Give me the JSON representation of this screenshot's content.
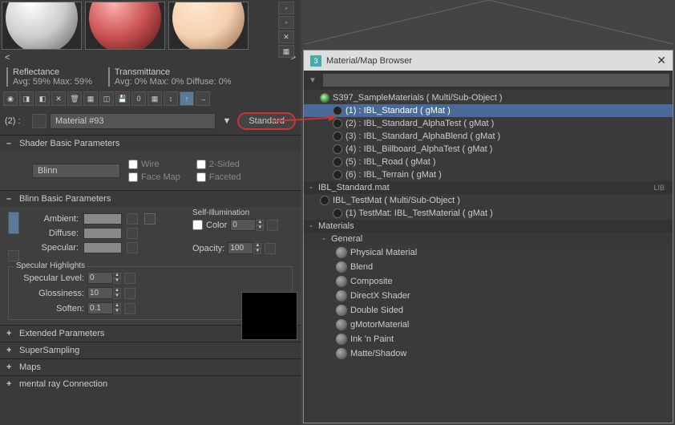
{
  "spheres": [
    "white",
    "red",
    "peach"
  ],
  "stats": {
    "reflectance": {
      "title": "Reflectance",
      "vals": "Avg: 59% Max: 59%"
    },
    "transmittance": {
      "title": "Transmittance",
      "vals": "Avg: 0% Max: 0% Diffuse: 0%"
    }
  },
  "material": {
    "slot_label": "(2) :",
    "name": "Material #93",
    "type_button": "Standard"
  },
  "rollouts": {
    "shader_basic": {
      "title": "Shader Basic Parameters",
      "shader": "Blinn",
      "checks": [
        "Wire",
        "2-Sided",
        "Face Map",
        "Faceted"
      ]
    },
    "blinn_basic": {
      "title": "Blinn Basic Parameters",
      "colors": [
        {
          "label": "Ambient:"
        },
        {
          "label": "Diffuse:"
        },
        {
          "label": "Specular:"
        }
      ],
      "self_illum": {
        "title": "Self-Illumination",
        "color_label": "Color",
        "value": "0"
      },
      "opacity": {
        "label": "Opacity:",
        "value": "100"
      },
      "spec_highlights": {
        "title": "Specular Highlights",
        "rows": [
          {
            "label": "Specular Level:",
            "value": "0"
          },
          {
            "label": "Glossiness:",
            "value": "10"
          },
          {
            "label": "Soften:",
            "value": "0.1"
          }
        ]
      }
    },
    "collapsed": [
      "Extended Parameters",
      "SuperSampling",
      "Maps",
      "mental ray Connection"
    ]
  },
  "browser": {
    "title": "Material/Map Browser",
    "search_placeholder": "",
    "sample_header": "S397_SampleMaterials ( Multi/Sub-Object )",
    "samples": [
      "(1) : IBL_Standard ( gMat )",
      "(2) : IBL_Standard_AlphaTest ( gMat )",
      "(3) : IBL_Standard_AlphaBlend ( gMat )",
      "(4) : IBL_Billboard_AlphaTest ( gMat )",
      "(5) : IBL_Road ( gMat )",
      "(6) : IBL_Terrain ( gMat )"
    ],
    "lib_header": "IBL_Standard.mat",
    "lib_tag": "LIB",
    "lib_items": [
      "IBL_TestMat ( Multi/Sub-Object )",
      "(1) TestMat: IBL_TestMaterial ( gMat )"
    ],
    "materials_header": "Materials",
    "general_header": "General",
    "general_items": [
      "Physical Material",
      "Blend",
      "Composite",
      "DirectX Shader",
      "Double Sided",
      "gMotorMaterial",
      "Ink 'n Paint",
      "Matte/Shadow"
    ]
  }
}
